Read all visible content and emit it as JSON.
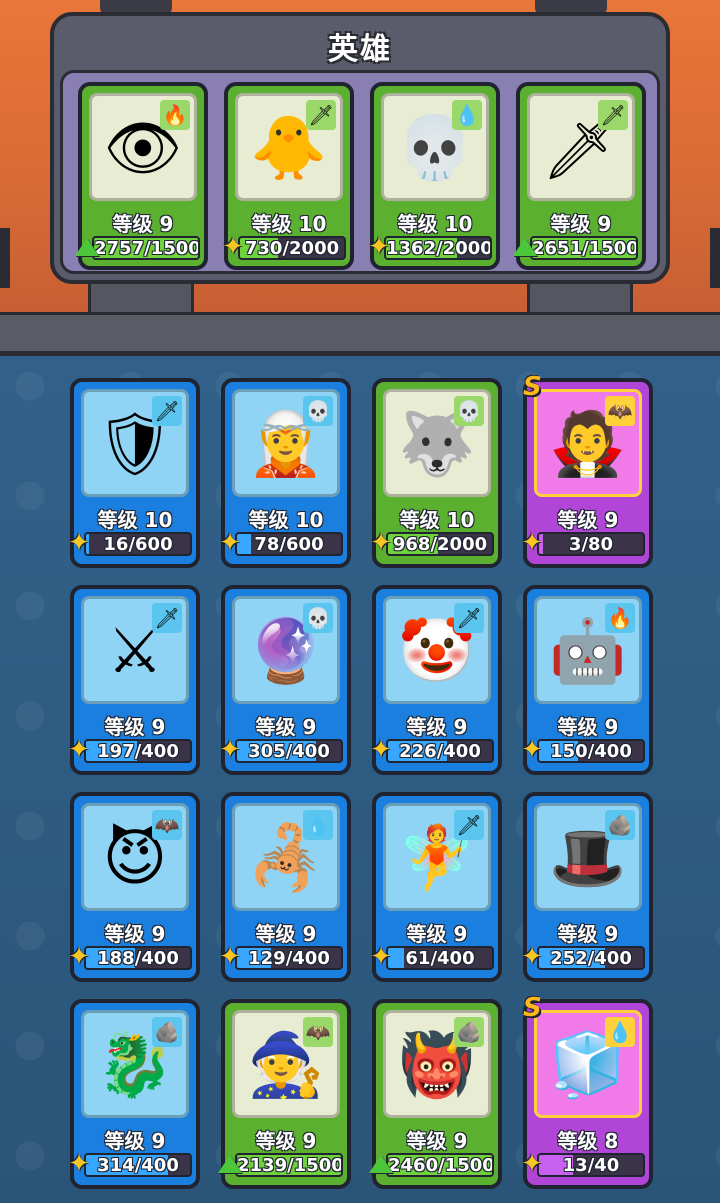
{
  "panel": {
    "title": "英雄"
  },
  "hero_row": [
    {
      "level": "等级 9",
      "progress": "2757/1500",
      "fill": 1.0,
      "rarity": "green",
      "element": "fire",
      "element_glyph": "🔥",
      "shard": "arrow",
      "portrait": "👁",
      "portrait_name": "eye-dragon-portrait"
    },
    {
      "level": "等级 10",
      "progress": "730/2000",
      "fill": 0.365,
      "rarity": "green",
      "element": "sword",
      "element_glyph": "🗡",
      "shard": "puzzle",
      "portrait": "🐥",
      "portrait_name": "chick-knight-portrait"
    },
    {
      "level": "等级 10",
      "progress": "1362/2000",
      "fill": 0.681,
      "rarity": "green",
      "element": "water",
      "element_glyph": "💧",
      "shard": "puzzle",
      "portrait": "💀",
      "portrait_name": "skull-druid-portrait"
    },
    {
      "level": "等级 9",
      "progress": "2651/1500",
      "fill": 1.0,
      "rarity": "green",
      "element": "sword",
      "element_glyph": "🗡",
      "shard": "arrow",
      "portrait": "🗡",
      "portrait_name": "crown-blade-portrait"
    }
  ],
  "collection": [
    {
      "level": "等级 10",
      "progress": "16/600",
      "fill": 0.027,
      "rarity": "blue",
      "element": "sword",
      "element_glyph": "🗡",
      "shard": "puzzle",
      "portrait": "🛡",
      "portrait_name": "horned-knight-portrait",
      "rank": ""
    },
    {
      "level": "等级 10",
      "progress": "78/600",
      "fill": 0.13,
      "rarity": "blue",
      "element": "skull",
      "element_glyph": "💀",
      "shard": "puzzle",
      "portrait": "🧝",
      "portrait_name": "elf-mage-portrait",
      "rank": ""
    },
    {
      "level": "等级 10",
      "progress": "968/2000",
      "fill": 0.484,
      "rarity": "green",
      "element": "skull",
      "element_glyph": "💀",
      "shard": "puzzle",
      "portrait": "🐺",
      "portrait_name": "anubis-portrait",
      "rank": ""
    },
    {
      "level": "等级 9",
      "progress": "3/80",
      "fill": 0.0375,
      "rarity": "purple",
      "element": "bat",
      "element_glyph": "🦇",
      "shard": "puzzle",
      "portrait": "🧛",
      "portrait_name": "vampire-portrait",
      "rank": "S"
    },
    {
      "level": "等级 9",
      "progress": "197/400",
      "fill": 0.4925,
      "rarity": "blue",
      "element": "sword",
      "element_glyph": "🗡",
      "shard": "puzzle",
      "portrait": "⚔",
      "portrait_name": "samurai-portrait",
      "rank": ""
    },
    {
      "level": "等级 9",
      "progress": "305/400",
      "fill": 0.7625,
      "rarity": "blue",
      "element": "skull",
      "element_glyph": "💀",
      "shard": "puzzle",
      "portrait": "🔮",
      "portrait_name": "orb-golem-portrait",
      "rank": ""
    },
    {
      "level": "等级 9",
      "progress": "226/400",
      "fill": 0.565,
      "rarity": "blue",
      "element": "sword",
      "element_glyph": "🗡",
      "shard": "puzzle",
      "portrait": "🤡",
      "portrait_name": "jester-portrait",
      "rank": ""
    },
    {
      "level": "等级 9",
      "progress": "150/400",
      "fill": 0.375,
      "rarity": "blue",
      "element": "fire",
      "element_glyph": "🔥",
      "shard": "puzzle",
      "portrait": "🤖",
      "portrait_name": "mech-portrait",
      "rank": ""
    },
    {
      "level": "等级 9",
      "progress": "188/400",
      "fill": 0.47,
      "rarity": "blue",
      "element": "bat",
      "element_glyph": "🦇",
      "shard": "puzzle",
      "portrait": "😈",
      "portrait_name": "demon-portrait",
      "rank": ""
    },
    {
      "level": "等级 9",
      "progress": "129/400",
      "fill": 0.3225,
      "rarity": "blue",
      "element": "water",
      "element_glyph": "💧",
      "shard": "puzzle",
      "portrait": "🦂",
      "portrait_name": "ice-wraith-portrait",
      "rank": ""
    },
    {
      "level": "等级 9",
      "progress": "61/400",
      "fill": 0.1525,
      "rarity": "blue",
      "element": "sword",
      "element_glyph": "🗡",
      "shard": "puzzle",
      "portrait": "🧚",
      "portrait_name": "winged-elf-portrait",
      "rank": ""
    },
    {
      "level": "等级 9",
      "progress": "252/400",
      "fill": 0.63,
      "rarity": "blue",
      "element": "rock",
      "element_glyph": "🪨",
      "shard": "puzzle",
      "portrait": "🎩",
      "portrait_name": "sombrero-portrait",
      "rank": ""
    },
    {
      "level": "等级 9",
      "progress": "314/400",
      "fill": 0.785,
      "rarity": "blue",
      "element": "rock",
      "element_glyph": "🪨",
      "shard": "puzzle",
      "portrait": "🐉",
      "portrait_name": "crystal-dragon-portrait",
      "rank": ""
    },
    {
      "level": "等级 9",
      "progress": "2139/1500",
      "fill": 1.0,
      "rarity": "green",
      "element": "bat",
      "element_glyph": "🦇",
      "shard": "arrow",
      "portrait": "🧙",
      "portrait_name": "witch-portrait",
      "rank": ""
    },
    {
      "level": "等级 9",
      "progress": "2460/1500",
      "fill": 1.0,
      "rarity": "green",
      "element": "rock",
      "element_glyph": "🪨",
      "shard": "arrow",
      "portrait": "👹",
      "portrait_name": "ogre-portrait",
      "rank": ""
    },
    {
      "level": "等级 8",
      "progress": "13/40",
      "fill": 0.325,
      "rarity": "purple",
      "element": "water",
      "element_glyph": "💧",
      "shard": "puzzle",
      "portrait": "🧊",
      "portrait_name": "frost-knight-portrait",
      "rank": "S"
    }
  ]
}
